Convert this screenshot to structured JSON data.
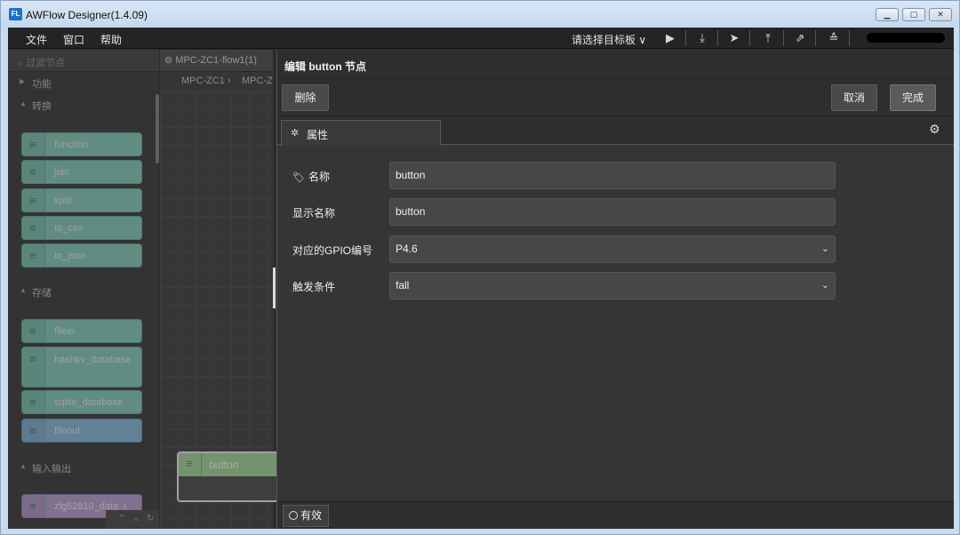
{
  "window": {
    "title": "AWFlow Designer(1.4.09)",
    "logo": "FL"
  },
  "menubar": {
    "items": [
      "文件",
      "窗口",
      "帮助"
    ],
    "target_select": "请选择目标板 ∨"
  },
  "palette": {
    "search_placeholder": "过滤节点",
    "categories": {
      "func": "功能",
      "convert": "转换",
      "storage": "存储",
      "io": "输入输出"
    },
    "convert_nodes": [
      "function",
      "join",
      "split",
      "to_csv",
      "to_json"
    ],
    "storage_nodes": [
      "filein",
      "hashkv_database",
      "sqlite_database",
      "fileout"
    ],
    "io_nodes": [
      "zlg52810_data_i"
    ]
  },
  "workspace": {
    "tab": "MPC-ZC1-flow1(1)",
    "breadcrumb": [
      "MPC-ZC1",
      "MPC-ZC"
    ],
    "canvas_node": "button"
  },
  "tray": {
    "title": "编辑 button 节点",
    "delete_label": "删除",
    "cancel_label": "取消",
    "done_label": "完成",
    "tab_label": "属性",
    "fields": {
      "name_label": "名称",
      "name_value": "button",
      "display_label": "显示名称",
      "display_value": "button",
      "gpio_label": "对应的GPIO编号",
      "gpio_value": "P4.6",
      "trigger_label": "触发条件",
      "trigger_value": "fall"
    },
    "footer_label": "有效"
  }
}
